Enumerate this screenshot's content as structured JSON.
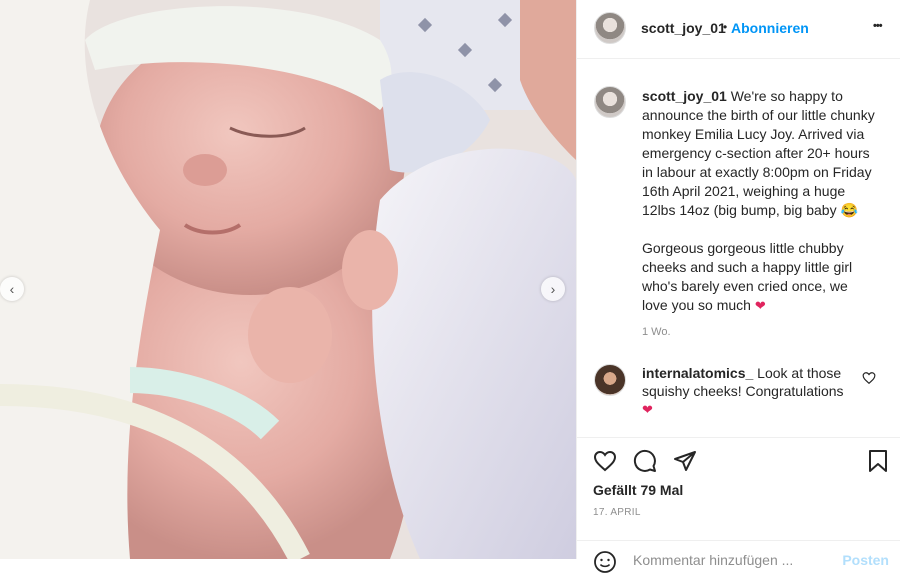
{
  "post": {
    "username": "scott_joy_01",
    "follow_separator": "•",
    "follow_label": "Abonnieren",
    "more_icon": "•••",
    "caption_user": "scott_joy_01",
    "caption_p1": " We're so happy to announce the birth of our little chunky monkey Emilia Lucy Joy. Arrived via emergency c-section after 20+ hours in labour at exactly 8:00pm on Friday 16th April 2021, weighing a huge 12lbs 14oz (big bump, big baby ",
    "caption_p1_emoji": "😂",
    "caption_p2": "Gorgeous gorgeous little chubby cheeks and such a happy little girl who's barely even cried once, we love you so much ",
    "caption_p2_emoji": "❤",
    "time_ago": "1 Wo.",
    "likes": "Gefällt 79 Mal",
    "date": "17. APRIL"
  },
  "comments": [
    {
      "username": "internalatomics_",
      "text": " Look at those squishy cheeks! Congratulations ",
      "emoji": "❤"
    }
  ],
  "comment_box": {
    "placeholder": "Kommentar hinzufügen ...",
    "post_label": "Posten"
  },
  "carousel": {
    "prev_glyph": "‹",
    "next_glyph": "›"
  },
  "colors": {
    "accent": "#0095f6",
    "heart": "#e0245e"
  }
}
